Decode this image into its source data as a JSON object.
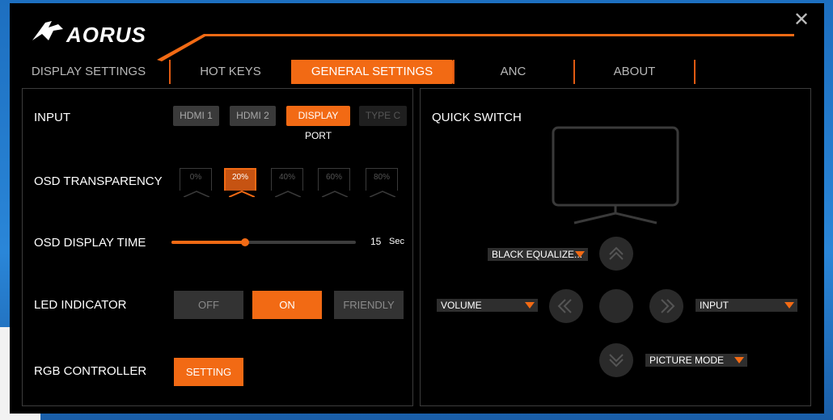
{
  "app": {
    "brand": "AORUS"
  },
  "tabs": [
    {
      "label": "DISPLAY SETTINGS"
    },
    {
      "label": "HOT KEYS"
    },
    {
      "label": "GENERAL SETTINGS"
    },
    {
      "label": "ANC"
    },
    {
      "label": "ABOUT"
    }
  ],
  "active_tab": "GENERAL SETTINGS",
  "input": {
    "label": "INPUT",
    "options": [
      "HDMI 1",
      "HDMI 2",
      "DISPLAY PORT",
      "TYPE C"
    ],
    "selected": "DISPLAY PORT",
    "disabled": [
      "TYPE C"
    ]
  },
  "osd_transparency": {
    "label": "OSD TRANSPARENCY",
    "options": [
      "0%",
      "20%",
      "40%",
      "60%",
      "80%"
    ],
    "selected": "20%"
  },
  "osd_display_time": {
    "label": "OSD DISPLAY TIME",
    "value": "15",
    "unit": "Sec",
    "fraction": 0.4
  },
  "led_indicator": {
    "label": "LED INDICATOR",
    "options": [
      "OFF",
      "ON",
      "FRIENDLY"
    ],
    "selected": "ON"
  },
  "rgb_controller": {
    "label": "RGB CONTROLLER",
    "button": "SETTING"
  },
  "quick_switch": {
    "title": "QUICK SWITCH",
    "up": "BLACK EQUALIZE...",
    "left": "VOLUME",
    "right": "INPUT",
    "down": "PICTURE MODE"
  },
  "colors": {
    "accent": "#f26a14",
    "background": "#000000"
  },
  "icons": {
    "close": "close-icon",
    "up": "chevron-up-icon",
    "left": "chevron-left-icon",
    "right": "chevron-right-icon",
    "down": "chevron-down-icon",
    "monitor": "monitor-icon"
  }
}
